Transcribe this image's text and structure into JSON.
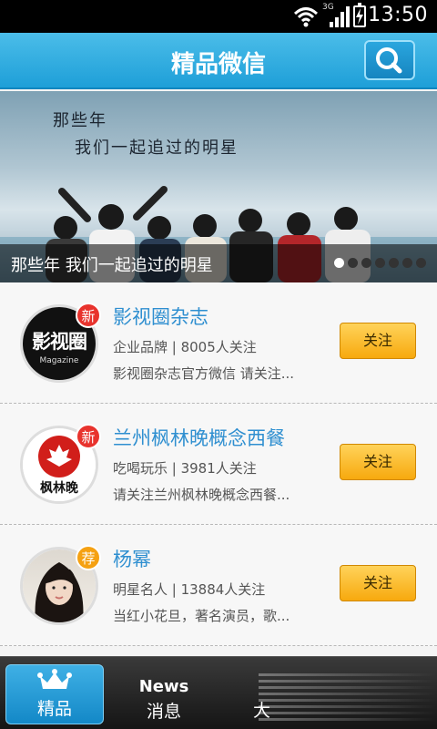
{
  "status_bar": {
    "time": "13:50",
    "network": "3G",
    "icons": [
      "wifi-icon",
      "signal-icon",
      "battery-charging-icon"
    ]
  },
  "header": {
    "title": "精品微信",
    "search_icon": "search-icon"
  },
  "banner": {
    "slogan_line1": "那些年",
    "slogan_line2": "我们一起追过的明星",
    "caption": "那些年 我们一起追过的明星",
    "dots_total": 7,
    "active_dot": 0
  },
  "accounts": [
    {
      "name": "影视圈杂志",
      "badge": "新",
      "badge_type": "new",
      "meta": "企业品牌 | 8005人关注",
      "description": "影视圈杂志官方微信 请关注...",
      "follow_label": "关注",
      "avatar_text": "影视圈",
      "avatar_subtext": "Magazine"
    },
    {
      "name": "兰州枫林晚概念西餐",
      "badge": "新",
      "badge_type": "new",
      "meta": "吃喝玩乐 | 3981人关注",
      "description": "请关注兰州枫林晚概念西餐...",
      "follow_label": "关注",
      "avatar_text": "枫林晚"
    },
    {
      "name": "杨幂",
      "badge": "荐",
      "badge_type": "recommend",
      "meta": "明星名人 | 13884人关注",
      "description": "当红小花旦，著名演员，歌...",
      "follow_label": "关注"
    }
  ],
  "bottom_nav": {
    "items": [
      {
        "label": "精品",
        "icon": "crown-icon",
        "active": true
      },
      {
        "label": "消息",
        "icon_text": "News",
        "active": false
      },
      {
        "label": "大",
        "active": false
      }
    ]
  },
  "colors": {
    "header_blue": "#1e9fd8",
    "follow_orange": "#f7a90e",
    "badge_new": "#e8332d",
    "badge_recommend": "#f5a112",
    "account_name": "#2f8fd0"
  }
}
